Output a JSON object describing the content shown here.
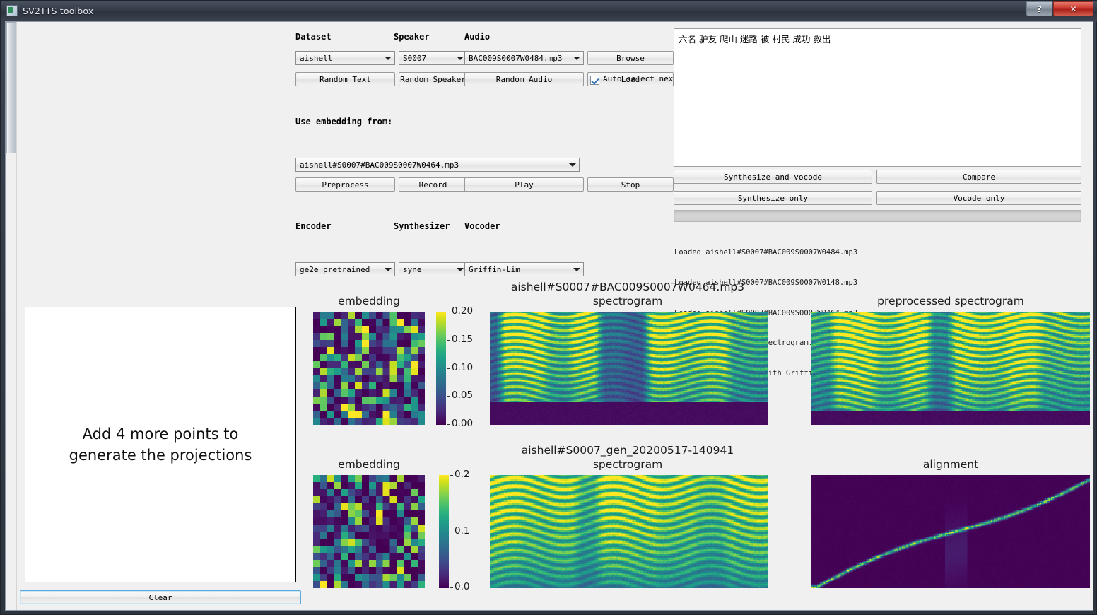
{
  "window": {
    "title": "SV2TTS toolbox",
    "icon": "app-icon",
    "buttons": [
      {
        "name": "help-button",
        "label": "?"
      },
      {
        "name": "close-button",
        "label": "✕"
      }
    ]
  },
  "controls": {
    "labels": {
      "dataset": "Dataset",
      "speaker": "Speaker",
      "audio": "Audio",
      "use_embedding_from": "Use embedding from:",
      "encoder": "Encoder",
      "synthesizer": "Synthesizer",
      "vocoder": "Vocoder"
    },
    "dataset_value": "aishell",
    "speaker_value": "S0007",
    "audio_value": "BAC009S0007W0484.mp3",
    "embedding_value": "aishell#S0007#BAC009S0007W0464.mp3",
    "encoder_value": "ge2e_pretrained",
    "synthesizer_value": "syne",
    "vocoder_value": "Griffin-Lim",
    "random_text": "Random Text",
    "random_speaker": "Random Speaker",
    "random_audio": "Random Audio",
    "browse": "Browse",
    "load": "Load",
    "auto_select_next": "Auto select next",
    "auto_select_checked": true,
    "preprocess": "Preprocess",
    "record": "Record",
    "play": "Play",
    "stop": "Stop"
  },
  "transcript": {
    "text": "六名 驴友 爬山 迷路 被 村民 成功 救出"
  },
  "actions": {
    "synthesize_and_vocode": "Synthesize and vocode",
    "compare": "Compare",
    "synthesize_only": "Synthesize only",
    "vocode_only": "Vocode only",
    "progress_value": 0
  },
  "log": {
    "lines": [
      "Loaded aishell#S0007#BAC009S0007W0484.mp3",
      "Loaded aishell#S0007#BAC009S0007W0148.mp3",
      "Loaded aishell#S0007#BAC009S0007W0464.mp3",
      "Generating the mel spectrogram...",
      "Waveform generation with Griffin-Lim...  Done!"
    ]
  },
  "projection": {
    "message_line1": "Add 4 more points to",
    "message_line2": "generate the projections",
    "clear_label": "Clear"
  },
  "plots": {
    "row1": {
      "embedding_title": "embedding",
      "spectrogram_title_line1": "aishell#S0007#BAC009S0007W0464.mp3",
      "spectrogram_title_line2": "spectrogram",
      "preprocessed_title": "preprocessed spectrogram",
      "colorbar_ticks": [
        "0.20",
        "0.15",
        "0.10",
        "0.05",
        "0.00"
      ]
    },
    "row2": {
      "embedding_title": "embedding",
      "spectrogram_title_line1": "aishell#S0007_gen_20200517-140941",
      "spectrogram_title_line2": "spectrogram",
      "alignment_title": "alignment",
      "colorbar_ticks": [
        "0.2",
        "0.1",
        "0.0"
      ]
    }
  },
  "colors": {
    "accent": "#5aaae0",
    "window_chrome": "#343c48",
    "close_button": "#c8372c",
    "client_bg": "#f0f0f0",
    "colormap": "viridis"
  },
  "chart_data": [
    {
      "type": "heatmap",
      "name": "embedding-utterance",
      "title": "embedding",
      "rows": 16,
      "cols": 16,
      "colormap": "viridis",
      "vmin": 0.0,
      "vmax": 0.21,
      "colorbar_ticks": [
        0.0,
        0.05,
        0.1,
        0.15,
        0.2
      ]
    },
    {
      "type": "heatmap",
      "name": "spectrogram-reference",
      "title": "aishell#S0007#BAC009S0007W0464.mp3 spectrogram",
      "colormap": "viridis",
      "xlabel": "",
      "ylabel": ""
    },
    {
      "type": "heatmap",
      "name": "preprocessed-spectrogram",
      "title": "preprocessed spectrogram",
      "colormap": "viridis"
    },
    {
      "type": "heatmap",
      "name": "embedding-generated",
      "title": "embedding",
      "rows": 16,
      "cols": 16,
      "colormap": "viridis",
      "vmin": 0.0,
      "vmax": 0.26,
      "colorbar_ticks": [
        0.0,
        0.1,
        0.2
      ]
    },
    {
      "type": "heatmap",
      "name": "spectrogram-generated",
      "title": "aishell#S0007_gen_20200517-140941 spectrogram",
      "colormap": "viridis"
    },
    {
      "type": "heatmap",
      "name": "alignment",
      "title": "alignment",
      "colormap": "viridis",
      "description": "monotonic diagonal attention alignment"
    }
  ]
}
